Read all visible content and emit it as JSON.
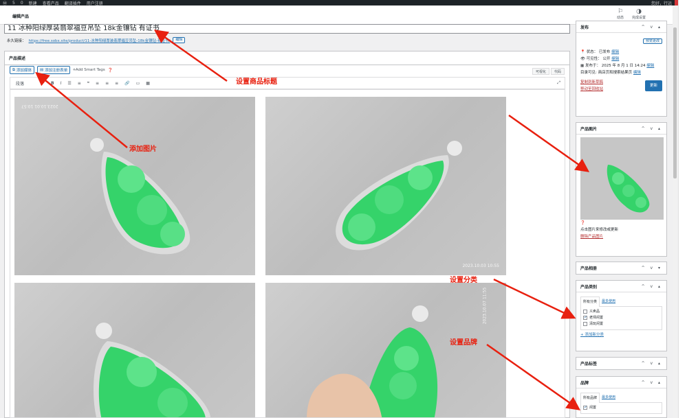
{
  "adminbar": {
    "items": [
      "⊕",
      "5",
      "0",
      "新建",
      "查看产品",
      "翻译插件",
      "用户注册"
    ],
    "greeting": "您好，行远"
  },
  "page": {
    "label": "编辑产品"
  },
  "topbar": {
    "activity": "动态",
    "finish": "完成设置"
  },
  "product": {
    "title": "11 冰种阳绿厚装翡翠福豆吊坠 18k金镶钻 有证书",
    "permalink_label": "永久链接：",
    "permalink_url": "https://free.sobx.site/product/11-冰种阳绿厚装翡翠福豆吊坠-18k金镶钻-有证书/",
    "edit": "编辑"
  },
  "editor": {
    "heading": "产品描述",
    "add_media": "添加媒体",
    "add_form": "添加注册表单",
    "smart_tags": "Add Smart Tags",
    "tab_visual": "可视化",
    "tab_code": "代码",
    "format_select": "段落",
    "timestamps": [
      "2023.10.01 10:57",
      "2023.10.03 10:55",
      "2023.10.07 11:55"
    ]
  },
  "publish": {
    "title": "发布",
    "preview": "预览更改",
    "status": "状态： 已发布",
    "status_edit": "编辑",
    "visibility": "可见性： 公开",
    "visibility_edit": "编辑",
    "published_on": "发布于： 2025 年 8 月 1 日 14:24",
    "published_edit": "编辑",
    "catalog": "目录可见: 商店页和搜索结果页",
    "catalog_edit": "编辑",
    "copy": "复制到新草稿",
    "trash": "移动至回收站",
    "update": "更新"
  },
  "product_image": {
    "title": "产品图片",
    "help": "点击图片来修改或更新",
    "remove": "删除产品图片"
  },
  "gallery": {
    "title": "产品相册"
  },
  "categories": {
    "title": "产品类别",
    "tab_all": "所有分类",
    "tab_common": "最多使用",
    "items": [
      {
        "label": "义卖品",
        "checked": false
      },
      {
        "label": "老师闲置",
        "checked": true
      },
      {
        "label": "清玩闲置",
        "checked": false
      }
    ],
    "add": "+ 添加新分类"
  },
  "tags": {
    "title": "产品标签"
  },
  "brand": {
    "title": "品牌",
    "tab_all": "所有品牌",
    "tab_common": "最多使用",
    "items": [
      {
        "label": "闲置",
        "checked": true
      }
    ]
  },
  "annotations": {
    "title": "设置商品标题",
    "image": "添加图片",
    "category": "设置分类",
    "brand": "设置品牌"
  },
  "colors": {
    "accent": "#2271b1",
    "annotation": "#e8200f",
    "jade": "#35d36a"
  }
}
